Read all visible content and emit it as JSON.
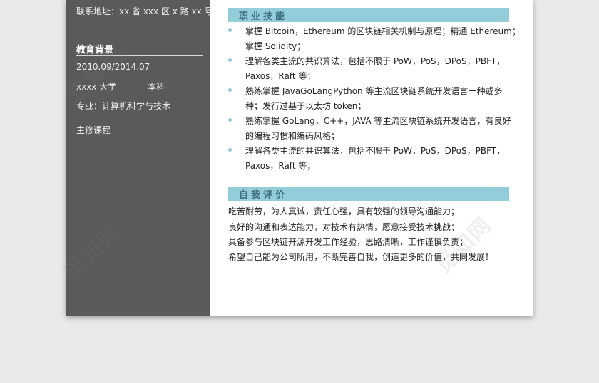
{
  "sidebar": {
    "address": "联系地址：xx 省 xxx 区 x 路 xx 号",
    "edu_heading": "教育背景",
    "edu_period": "2010.09/2014.07",
    "edu_school": "xxxx 大学",
    "edu_degree": "本科",
    "edu_major": "专业：计算机科学与技术",
    "edu_courses": "主修课程"
  },
  "skills": {
    "title": "职业技能",
    "items": [
      {
        "lines": [
          "掌握 Bitcoin，Ethereum 的区块链相关机制与原理；精通 Ethereum；",
          "掌握 Solidity；"
        ]
      },
      {
        "lines": [
          "理解各类主流的共识算法，包括不限于 PoW，PoS，DPoS，PBFT，",
          "Paxos，Raft 等；"
        ]
      },
      {
        "lines": [
          "熟练掌握 JavaGoLangPython 等主流区块链系统开发语言一种或多",
          "种；发行过基于以太坊 token；"
        ]
      },
      {
        "lines": [
          "熟练掌握 GoLang，C++，JAVA 等主流区块链系统开发语言，有良好",
          "的编程习惯和编码风格；"
        ]
      },
      {
        "lines": [
          "理解各类主流的共识算法，包括不限于 PoW，PoS，DPoS，PBFT，",
          "Paxos，Raft 等；"
        ]
      }
    ]
  },
  "evaluation": {
    "title": "自我评价",
    "lines": [
      "吃苦耐劳，为人真诚，责任心强，具有较强的领导沟通能力；",
      "良好的沟通和表达能力，对技术有热情，愿意接受技术挑战；",
      "具备参与区块链开源开发工作经验，思路清晰，工作谨慎负责；",
      "希望自己能为公司所用，不断完善自我，创造更多的价值，共同发展！"
    ]
  },
  "watermark": "觅知网",
  "colors": {
    "sidebar": "#5a5a5a",
    "accent": "#92cdd9",
    "background": "#e9e9ea"
  }
}
